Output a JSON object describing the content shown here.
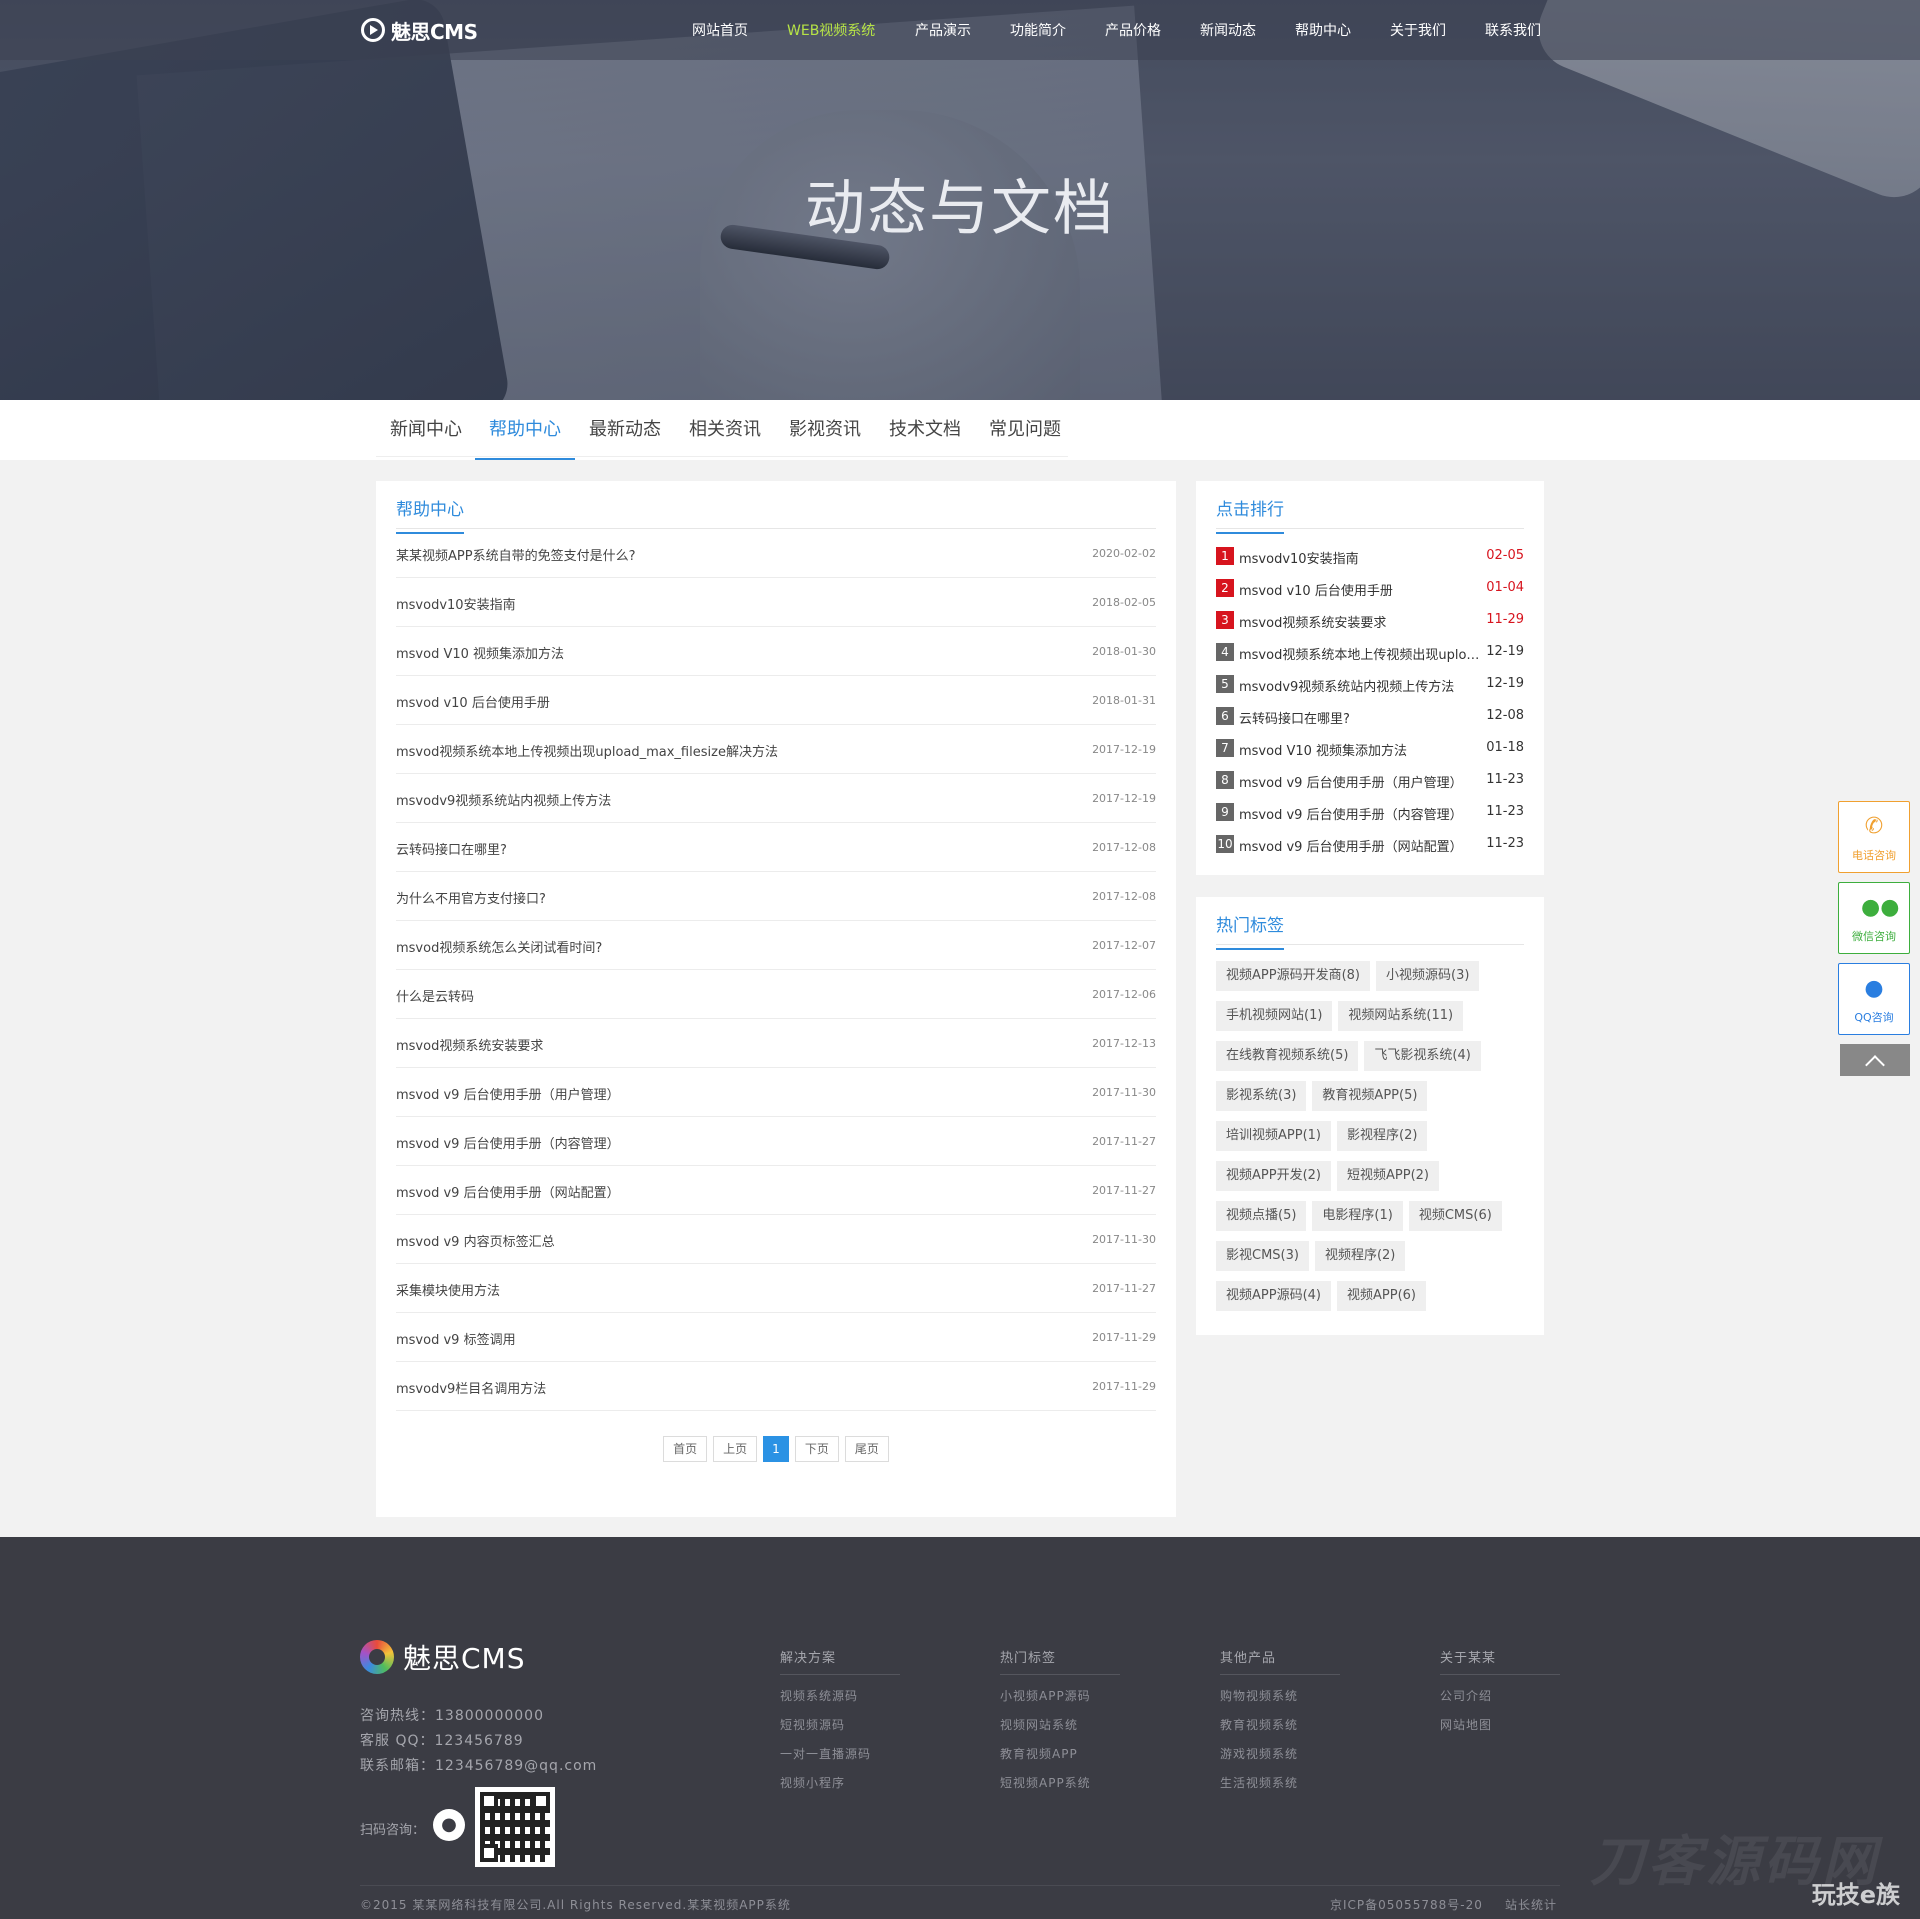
{
  "header": {
    "logo_text": "魅思CMS",
    "nav": [
      {
        "label": "网站首页",
        "active": false
      },
      {
        "label": "WEB视频系统",
        "active": true
      },
      {
        "label": "产品演示",
        "active": false
      },
      {
        "label": "功能简介",
        "active": false
      },
      {
        "label": "产品价格",
        "active": false
      },
      {
        "label": "新闻动态",
        "active": false
      },
      {
        "label": "帮助中心",
        "active": false
      },
      {
        "label": "关于我们",
        "active": false
      },
      {
        "label": "联系我们",
        "active": false
      }
    ],
    "accent": "#b6e346"
  },
  "hero": {
    "title": "动态与文档"
  },
  "subnav": {
    "tabs": [
      {
        "label": "新闻中心",
        "active": false
      },
      {
        "label": "帮助中心",
        "active": true
      },
      {
        "label": "最新动态",
        "active": false
      },
      {
        "label": "相关资讯",
        "active": false
      },
      {
        "label": "影视资讯",
        "active": false
      },
      {
        "label": "技术文档",
        "active": false
      },
      {
        "label": "常见问题",
        "active": false
      }
    ],
    "accent": "#2f8bdc"
  },
  "main": {
    "title": "帮助中心",
    "articles": [
      {
        "title": "某某视频APP系统自带的免签支付是什么?",
        "date": "2020-02-02"
      },
      {
        "title": "msvodv10安装指南",
        "date": "2018-02-05"
      },
      {
        "title": "msvod V10 视频集添加方法",
        "date": "2018-01-30"
      },
      {
        "title": "msvod v10 后台使用手册",
        "date": "2018-01-31"
      },
      {
        "title": "msvod视频系统本地上传视频出现upload_max_filesize解决方法",
        "date": "2017-12-19"
      },
      {
        "title": "msvodv9视频系统站内视频上传方法",
        "date": "2017-12-19"
      },
      {
        "title": "云转码接口在哪里?",
        "date": "2017-12-08"
      },
      {
        "title": "为什么不用官方支付接口?",
        "date": "2017-12-08"
      },
      {
        "title": "msvod视频系统怎么关闭试看时间?",
        "date": "2017-12-07"
      },
      {
        "title": "什么是云转码",
        "date": "2017-12-06"
      },
      {
        "title": "msvod视频系统安装要求",
        "date": "2017-12-13"
      },
      {
        "title": "msvod v9 后台使用手册（用户管理）",
        "date": "2017-11-30"
      },
      {
        "title": "msvod v9 后台使用手册（内容管理）",
        "date": "2017-11-27"
      },
      {
        "title": "msvod v9 后台使用手册（网站配置）",
        "date": "2017-11-27"
      },
      {
        "title": "msvod v9 内容页标签汇总",
        "date": "2017-11-30"
      },
      {
        "title": "采集模块使用方法",
        "date": "2017-11-27"
      },
      {
        "title": "msvod v9 标签调用",
        "date": "2017-11-29"
      },
      {
        "title": "msvodv9栏目名调用方法",
        "date": "2017-11-29"
      }
    ],
    "pager": {
      "first": "首页",
      "prev": "上页",
      "current": "1",
      "next": "下页",
      "last": "尾页"
    }
  },
  "ranking": {
    "title": "点击排行",
    "items": [
      {
        "num": "1",
        "title": "msvodv10安装指南",
        "date": "02-05",
        "hot": true
      },
      {
        "num": "2",
        "title": "msvod v10 后台使用手册",
        "date": "01-04",
        "hot": true
      },
      {
        "num": "3",
        "title": "msvod视频系统安装要求",
        "date": "11-29",
        "hot": true
      },
      {
        "num": "4",
        "title": "msvod视频系统本地上传视频出现upload_max_filesize解决方法",
        "date": "12-19",
        "hot": false
      },
      {
        "num": "5",
        "title": "msvodv9视频系统站内视频上传方法",
        "date": "12-19",
        "hot": false
      },
      {
        "num": "6",
        "title": "云转码接口在哪里?",
        "date": "12-08",
        "hot": false
      },
      {
        "num": "7",
        "title": "msvod V10 视频集添加方法",
        "date": "01-18",
        "hot": false
      },
      {
        "num": "8",
        "title": "msvod v9 后台使用手册（用户管理）",
        "date": "11-23",
        "hot": false
      },
      {
        "num": "9",
        "title": "msvod v9 后台使用手册（内容管理）",
        "date": "11-23",
        "hot": false
      },
      {
        "num": "10",
        "title": "msvod v9 后台使用手册（网站配置）",
        "date": "11-23",
        "hot": false
      }
    ],
    "hot_color": "#d7141e"
  },
  "tags": {
    "title": "热门标签",
    "items": [
      "视频APP源码开发商(8)",
      "小视频源码(3)",
      "手机视频网站(1)",
      "视频网站系统(11)",
      "在线教育视频系统(5)",
      "飞飞影视系统(4)",
      "影视系统(3)",
      "教育视频APP(5)",
      "培训视频APP(1)",
      "影视程序(2)",
      "视频APP开发(2)",
      "短视频APP(2)",
      "视频点播(5)",
      "电影程序(1)",
      "视频CMS(6)",
      "影视CMS(3)",
      "视频程序(2)",
      "视频APP源码(4)",
      "视频APP(6)"
    ]
  },
  "float": {
    "phone": {
      "label": "电话咨询",
      "color": "#f0a030"
    },
    "wechat": {
      "label": "微信咨询",
      "color": "#3dae3d"
    },
    "qq": {
      "label": "QQ咨询",
      "color": "#2a7ee0"
    }
  },
  "footer": {
    "logo_text": "魅思CMS",
    "contact": {
      "hotline": "咨询热线：13800000000",
      "qq": "客服 QQ：123456789",
      "email": "联系邮箱：123456789@qq.com"
    },
    "scan_label": "扫码咨询：",
    "columns": [
      {
        "title": "解决方案",
        "items": [
          "视频系统源码",
          "短视频源码",
          "一对一直播源码",
          "视频小程序"
        ]
      },
      {
        "title": "热门标签",
        "items": [
          "小视频APP源码",
          "视频网站系统",
          "教育视频APP",
          "短视频APP系统"
        ]
      },
      {
        "title": "其他产品",
        "items": [
          "购物视频系统",
          "教育视频系统",
          "游戏视频系统",
          "生活视频系统"
        ]
      },
      {
        "title": "关于某某",
        "items": [
          "公司介绍",
          "网站地图"
        ]
      }
    ],
    "copyright": "©2015 某某网络科技有限公司.All Rights Reserved.某某视频APP系统",
    "icp": "京ICP备05055788号-20",
    "stat": "站长统计",
    "watermark": "刀客源码网",
    "watermark2": "玩技e族"
  }
}
